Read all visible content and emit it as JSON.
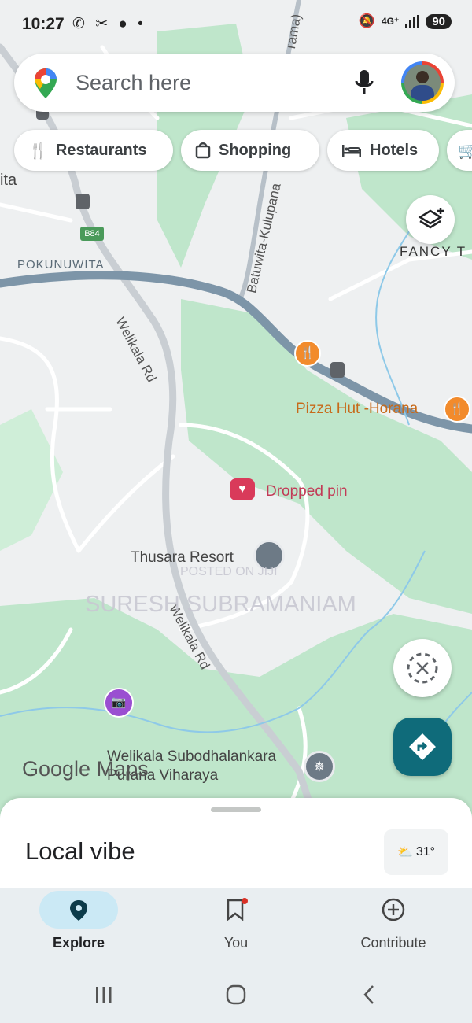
{
  "status_bar": {
    "time": "10:27",
    "left_icons": "✆ ✂ ● •",
    "network": "4G⁺",
    "battery": "90"
  },
  "search": {
    "placeholder": "Search here"
  },
  "chips": [
    {
      "icon": "restaurant-icon",
      "label": "Restaurants"
    },
    {
      "icon": "shopping-bag-icon",
      "label": "Shopping"
    },
    {
      "icon": "bed-icon",
      "label": "Hotels"
    }
  ],
  "map": {
    "labels": {
      "ita": "ita",
      "road_shield": "B84",
      "pokunuwita": "POKUNUWITA",
      "welikala_rd_1": "Welikala Rd",
      "welikala_rd_2": "Welikala Rd",
      "batuwita": "Batuwita-Kulupana",
      "rama": "rama)",
      "fancy": "FANCY T",
      "pizza_hut": "Pizza Hut -Horana",
      "dropped_pin": "Dropped pin",
      "thusara": "Thusara Resort",
      "temple_line1": "Welikala Subodhalankara",
      "temple_line2": "Purana Viharaya",
      "google_maps": "Google Maps"
    },
    "watermark": {
      "line1": "POSTED ON JIJI",
      "line2": "SURESH SUBRAMANIAM"
    }
  },
  "sheet": {
    "title": "Local vibe",
    "weather": "31°"
  },
  "bottom_nav": [
    {
      "label": "Explore",
      "icon": "location-pin-icon",
      "active": true
    },
    {
      "label": "You",
      "icon": "bookmark-icon",
      "active": false
    },
    {
      "label": "Contribute",
      "icon": "add-circle-icon",
      "active": false
    }
  ],
  "colors": {
    "accent": "#0f6b7a",
    "map_green": "#bfe6cb",
    "road": "#7d95a8",
    "poi_orange": "#f28b2c",
    "dropped_pin": "#d93a5a",
    "active_pill": "#cbe9f5"
  }
}
